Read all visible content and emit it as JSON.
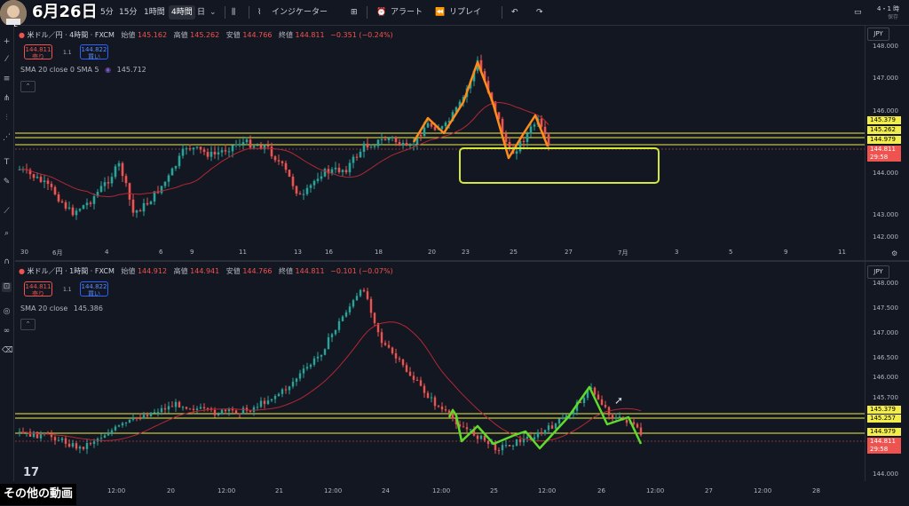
{
  "header": {
    "date_title": "6月26日",
    "symbol_short": "U",
    "intervals": [
      "5分",
      "15分",
      "1時間",
      "4時間",
      "日"
    ],
    "active_interval": "4時間",
    "indicators_label": "インジケーター",
    "alert_label": "アラート",
    "replay_label": "リプレイ",
    "right_label": "4・1 時",
    "right_sub": "保存"
  },
  "pane_top": {
    "symbol": "米ドル／円 · 4時間 · FXCM",
    "open_label": "始値",
    "open": "145.162",
    "high_label": "高値",
    "high": "145.262",
    "low_label": "安値",
    "low": "144.766",
    "close_label": "終値",
    "close": "144.811",
    "change": "−0.351 (−0.24%)",
    "sell_price": "144.811",
    "sell_label": "売り",
    "buy_price": "144.822",
    "buy_label": "買い",
    "spread": "1.1",
    "sma_label": "SMA 20 close 0 SMA 5",
    "sma_value": "145.712",
    "currency": "JPY",
    "price_ticks": [
      "148.000",
      "147.000",
      "146.000",
      "144.000",
      "143.000",
      "142.000"
    ],
    "price_labels": [
      {
        "text": "145.379",
        "bg": "#f2ed4a",
        "fg": "#000000"
      },
      {
        "text": "145.262",
        "bg": "#f2ed4a",
        "fg": "#000000"
      },
      {
        "text": "144.979",
        "bg": "#f2ed4a",
        "fg": "#000000"
      },
      {
        "text": "144.811",
        "bg": "#ef5350",
        "fg": "#ffffff"
      },
      {
        "text": "29:58",
        "bg": "#ef5350",
        "fg": "#ffffff"
      }
    ],
    "x_ticks": [
      "30",
      "6月",
      "4",
      "6",
      "9",
      "11",
      "13",
      "16",
      "18",
      "20",
      "23",
      "25",
      "27",
      "7月",
      "3",
      "5",
      "9",
      "11"
    ]
  },
  "pane_bottom": {
    "symbol": "米ドル／円 · 1時間 · FXCM",
    "open_label": "始値",
    "open": "144.912",
    "high_label": "高値",
    "high": "144.941",
    "low_label": "安値",
    "low": "144.766",
    "close_label": "終値",
    "close": "144.811",
    "change": "−0.101 (−0.07%)",
    "sell_price": "144.811",
    "sell_label": "売り",
    "buy_price": "144.822",
    "buy_label": "買い",
    "spread": "1.1",
    "sma_label": "SMA 20 close",
    "sma_value": "145.386",
    "currency": "JPY",
    "price_ticks": [
      "148.000",
      "147.500",
      "147.000",
      "146.500",
      "146.000",
      "145.700",
      "145.500",
      "144.500",
      "144.000"
    ],
    "price_labels": [
      {
        "text": "145.379",
        "bg": "#f2ed4a",
        "fg": "#000000"
      },
      {
        "text": "145.257",
        "bg": "#f2ed4a",
        "fg": "#000000"
      },
      {
        "text": "144.979",
        "bg": "#f2ed4a",
        "fg": "#000000"
      },
      {
        "text": "144.811",
        "bg": "#ef5350",
        "fg": "#ffffff"
      },
      {
        "text": "29:58",
        "bg": "#ef5350",
        "fg": "#ffffff"
      }
    ],
    "x_ticks": [
      "12:00",
      "20",
      "12:00",
      "21",
      "12:00",
      "24",
      "12:00",
      "25",
      "12:00",
      "26",
      "12:00",
      "27",
      "12:00",
      "28"
    ]
  },
  "footer": {
    "more_videos": "その他の動画",
    "logo": "17"
  },
  "colors": {
    "up": "#26a69a",
    "down": "#ef5350",
    "sma": "#b22833",
    "hline": "#f2ed4a",
    "drawing_orange": "#ff8c1a",
    "drawing_green": "#5fd92b",
    "box": "#d4e83a"
  }
}
